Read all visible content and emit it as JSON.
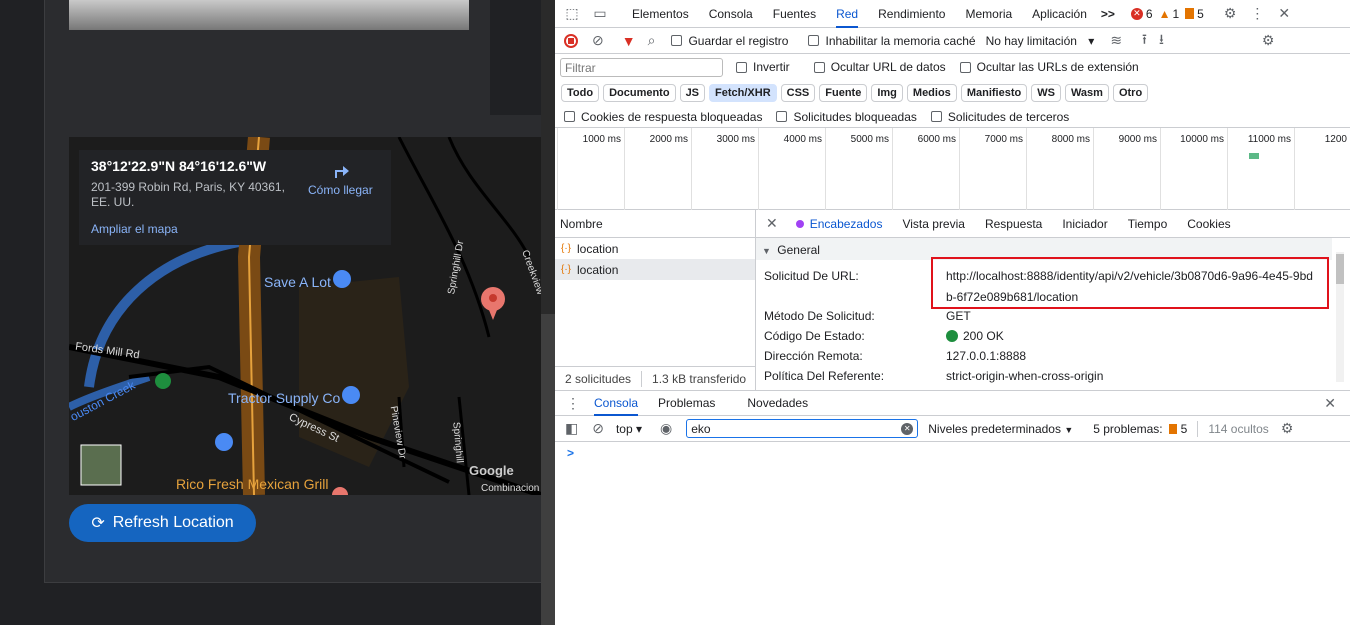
{
  "map": {
    "coords": "38°12'22.9\"N 84°16'12.6\"W",
    "address": "201-399 Robin Rd, Paris, KY 40361, EE. UU.",
    "directions": "Cómo llegar",
    "enlarge": "Ampliar el mapa",
    "labels": {
      "save_a_lot": "Save A Lot",
      "tractor_supply": "Tractor Supply Co",
      "rico_fresh": "Rico Fresh Mexican Grill",
      "fords_mill": "Fords Mill Rd",
      "cypress": "Cypress St",
      "pineview": "Pineview Dr",
      "springhill1": "Springhill Dr",
      "springhill2": "Springhill",
      "creekview": "Creekview",
      "houston_creek": "ouston Creek",
      "google": "Google",
      "combinacion": "Combinacion"
    }
  },
  "refresh_label": "Refresh Location",
  "devtools": {
    "tabs": [
      "Elementos",
      "Consola",
      "Fuentes",
      "Red",
      "Rendimiento",
      "Memoria",
      "Aplicación"
    ],
    "active_tab": "Red",
    "more": ">>",
    "errors": "6",
    "warnings": "1",
    "issues": "5",
    "toolbar": {
      "preserve_log": "Guardar el registro",
      "disable_cache": "Inhabilitar la memoria caché",
      "throttle": "No hay limitación"
    },
    "filter": {
      "placeholder": "Filtrar",
      "invert": "Invertir",
      "hide_data_urls": "Ocultar URL de datos",
      "hide_ext_urls": "Ocultar las URLs de extensión"
    },
    "types": [
      "Todo",
      "Documento",
      "JS",
      "Fetch/XHR",
      "CSS",
      "Fuente",
      "Img",
      "Medios",
      "Manifiesto",
      "WS",
      "Wasm",
      "Otro"
    ],
    "selected_type": "Fetch/XHR",
    "cookies": {
      "blocked_response": "Cookies de respuesta bloqueadas",
      "blocked_requests": "Solicitudes bloqueadas",
      "third_party": "Solicitudes de terceros"
    },
    "timeline_ticks": [
      "1000 ms",
      "2000 ms",
      "3000 ms",
      "4000 ms",
      "5000 ms",
      "6000 ms",
      "7000 ms",
      "8000 ms",
      "9000 ms",
      "10000 ms",
      "11000 ms",
      "1200"
    ],
    "names_header": "Nombre",
    "requests": [
      "location",
      "location"
    ],
    "footer_requests": "2 solicitudes",
    "footer_transferred": "1.3 kB transferido",
    "detail_tabs": [
      "Encabezados",
      "Vista previa",
      "Respuesta",
      "Iniciador",
      "Tiempo",
      "Cookies"
    ],
    "general_label": "General",
    "headers": {
      "url_key": "Solicitud De URL:",
      "url_value_1": "http://localhost:8888/identity/api/v2/vehicle/3b0870d6-9a96-4e45-9bd",
      "url_value_2": "b-6f72e089b681/location",
      "method_key": "Método De Solicitud:",
      "method_value": "GET",
      "status_key": "Código De Estado:",
      "status_value": "200 OK",
      "remote_key": "Dirección Remota:",
      "remote_value": "127.0.0.1:8888",
      "referrer_key": "Política Del Referente:",
      "referrer_value": "strict-origin-when-cross-origin"
    },
    "drawer_tabs": [
      "Consola",
      "Problemas",
      "Novedades"
    ],
    "console": {
      "context": "top",
      "filter_value": "eko",
      "levels": "Niveles predeterminados",
      "problems_label": "5 problemas:",
      "problems_count": "5",
      "hidden": "114 ocultos",
      "prompt": ">"
    }
  }
}
